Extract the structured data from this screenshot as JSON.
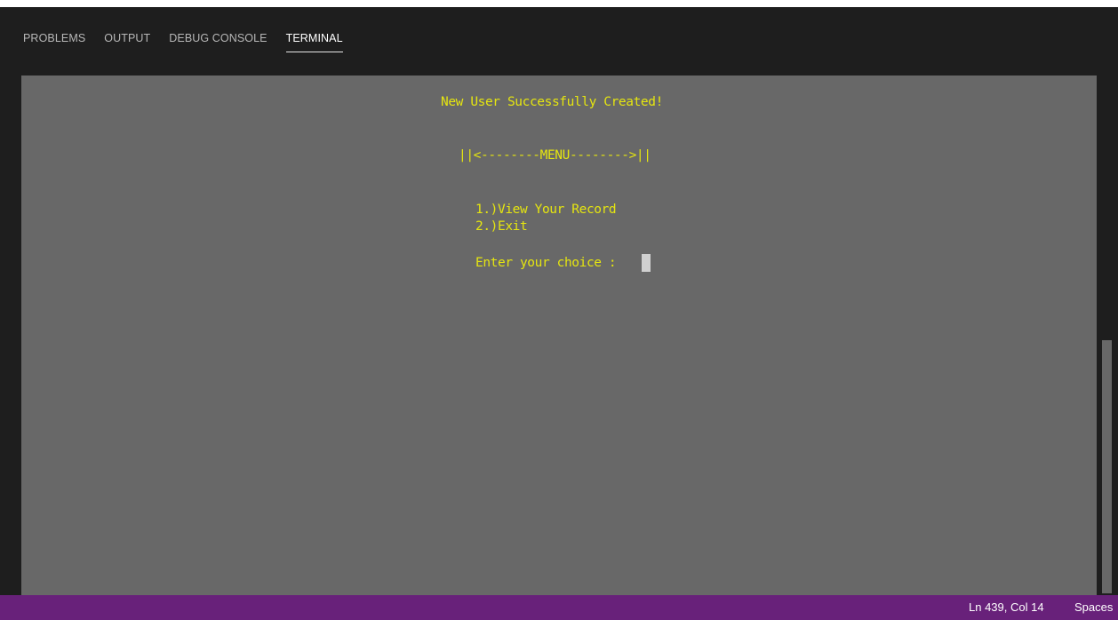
{
  "panel": {
    "tabs": [
      {
        "label": "PROBLEMS"
      },
      {
        "label": "OUTPUT"
      },
      {
        "label": "DEBUG CONSOLE"
      },
      {
        "label": "TERMINAL",
        "active": true
      }
    ]
  },
  "terminal": {
    "lines": [
      "New User Successfully Created!",
      "||<--------MENU-------->||",
      "1.)View Your Record",
      "2.)Exit",
      "Enter your choice :"
    ],
    "text_color": "#e5e510",
    "background": "#686868"
  },
  "statusbar": {
    "position": "Ln 439, Col 14",
    "indent": "Spaces",
    "background": "#68217a"
  }
}
